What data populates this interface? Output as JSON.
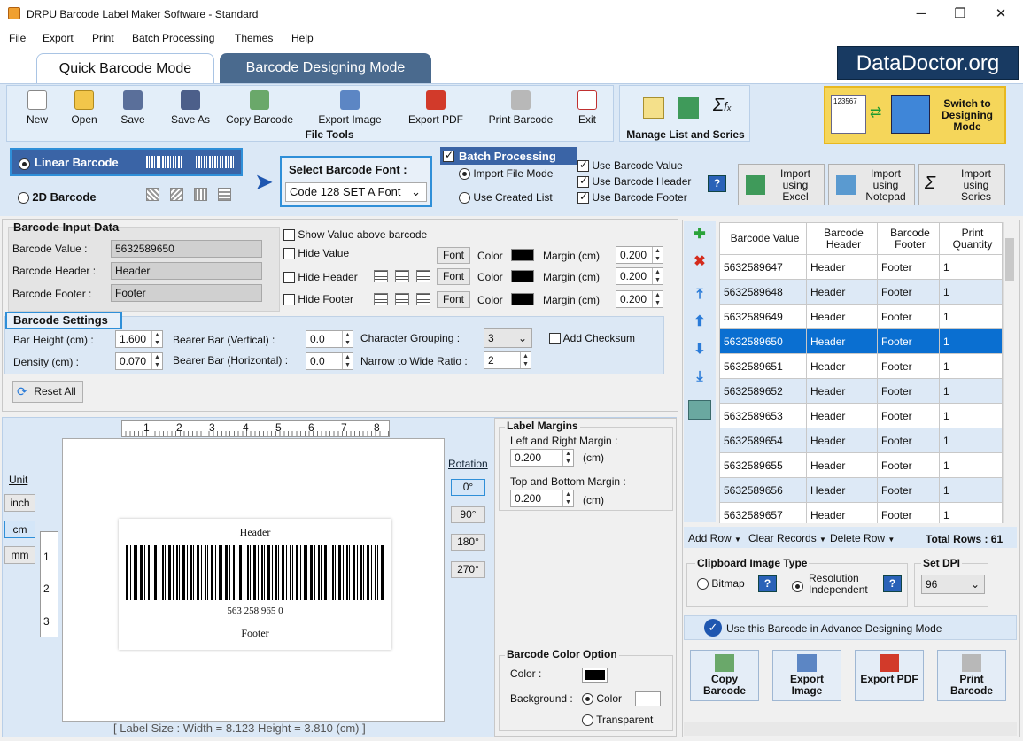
{
  "window": {
    "title": "DRPU Barcode Label Maker Software - Standard",
    "minimize": "─",
    "maximize": "❐",
    "close": "✕"
  },
  "menu": [
    "File",
    "Export",
    "Print",
    "Batch Processing",
    "Themes",
    "Help"
  ],
  "tabs": {
    "quick": "Quick Barcode Mode",
    "designing": "Barcode Designing Mode"
  },
  "logo": "DataDoctor.org",
  "toolbar": {
    "new": "New",
    "open": "Open",
    "save": "Save",
    "save_as": "Save As",
    "copy_barcode": "Copy Barcode",
    "export_image": "Export Image",
    "export_pdf": "Export PDF",
    "print_barcode": "Print Barcode",
    "exit": "Exit",
    "file_tools": "File Tools",
    "manage": "Manage List and Series",
    "switch": "Switch to Designing Mode",
    "switch_sample": "123567"
  },
  "barcode_type": {
    "linear": "Linear Barcode",
    "twod": "2D Barcode"
  },
  "font": {
    "label": "Select Barcode Font :",
    "value": "Code 128 SET A Font"
  },
  "batch": {
    "title": "Batch Processing",
    "import_file": "Import File Mode",
    "use_created": "Use Created List",
    "use_value": "Use Barcode Value",
    "use_header": "Use Barcode Header",
    "use_footer": "Use Barcode Footer",
    "help": "?",
    "excel": "Import using Excel",
    "notepad": "Import using Notepad",
    "series": "Import using Series"
  },
  "input": {
    "title": "Barcode Input Data",
    "value_label": "Barcode Value :",
    "value": "5632589650",
    "header_label": "Barcode Header :",
    "header": "Header",
    "footer_label": "Barcode Footer :",
    "footer": "Footer",
    "show_above": "Show Value above barcode",
    "hide_value": "Hide Value",
    "hide_header": "Hide Header",
    "hide_footer": "Hide Footer",
    "font": "Font",
    "color": "Color",
    "margin": "Margin (cm)",
    "m1": "0.200",
    "m2": "0.200",
    "m3": "0.200"
  },
  "settings": {
    "title": "Barcode Settings",
    "bar_height_label": "Bar Height (cm) :",
    "bar_height": "1.600",
    "density_label": "Density (cm) :",
    "density": "0.070",
    "bearer_v_label": "Bearer Bar (Vertical) :",
    "bearer_v": "0.0",
    "bearer_h_label": "Bearer Bar (Horizontal) :",
    "bearer_h": "0.0",
    "char_group_label": "Character Grouping :",
    "char_group": "3",
    "ratio_label": "Narrow to Wide Ratio :",
    "ratio": "2",
    "checksum": "Add Checksum",
    "reset": "Reset All"
  },
  "preview": {
    "unit": "Unit",
    "inch": "inch",
    "cm": "cm",
    "mm": "mm",
    "ruler_top": [
      "1",
      "2",
      "3",
      "4",
      "5",
      "6",
      "7",
      "8"
    ],
    "ruler_left": [
      "1",
      "2",
      "3"
    ],
    "header": "Header",
    "value_text": "563 258 965 0",
    "footer": "Footer",
    "rotation": "Rotation",
    "r0": "0°",
    "r90": "90°",
    "r180": "180°",
    "r270": "270°",
    "label_size": "[ Label Size : Width = 8.123  Height = 3.810 (cm) ]"
  },
  "margins": {
    "title": "Label Margins",
    "lr_label": "Left and Right Margin :",
    "lr": "0.200",
    "tb_label": "Top and Bottom Margin :",
    "tb": "0.200",
    "unit": "(cm)"
  },
  "color_opt": {
    "title": "Barcode Color Option",
    "color_label": "Color :",
    "bg_label": "Background :",
    "color": "Color",
    "transparent": "Transparent"
  },
  "table": {
    "headers": [
      "Barcode Value",
      "Barcode Header",
      "Barcode Footer",
      "Print Quantity"
    ],
    "rows": [
      [
        "5632589647",
        "Header",
        "Footer",
        "1"
      ],
      [
        "5632589648",
        "Header",
        "Footer",
        "1"
      ],
      [
        "5632589649",
        "Header",
        "Footer",
        "1"
      ],
      [
        "5632589650",
        "Header",
        "Footer",
        "1"
      ],
      [
        "5632589651",
        "Header",
        "Footer",
        "1"
      ],
      [
        "5632589652",
        "Header",
        "Footer",
        "1"
      ],
      [
        "5632589653",
        "Header",
        "Footer",
        "1"
      ],
      [
        "5632589654",
        "Header",
        "Footer",
        "1"
      ],
      [
        "5632589655",
        "Header",
        "Footer",
        "1"
      ],
      [
        "5632589656",
        "Header",
        "Footer",
        "1"
      ],
      [
        "5632589657",
        "Header",
        "Footer",
        "1"
      ]
    ],
    "selected_index": 3,
    "add_row": "Add Row",
    "clear": "Clear Records",
    "delete": "Delete Row",
    "total": "Total Rows : 61"
  },
  "clipboard": {
    "title": "Clipboard Image Type",
    "bitmap": "Bitmap",
    "resolution": "Resolution Independent",
    "dpi_title": "Set DPI",
    "dpi": "96",
    "advance": "Use this Barcode in Advance Designing Mode"
  },
  "bottom_buttons": {
    "copy": "Copy Barcode",
    "export_image": "Export Image",
    "export_pdf": "Export PDF",
    "print": "Print Barcode"
  }
}
